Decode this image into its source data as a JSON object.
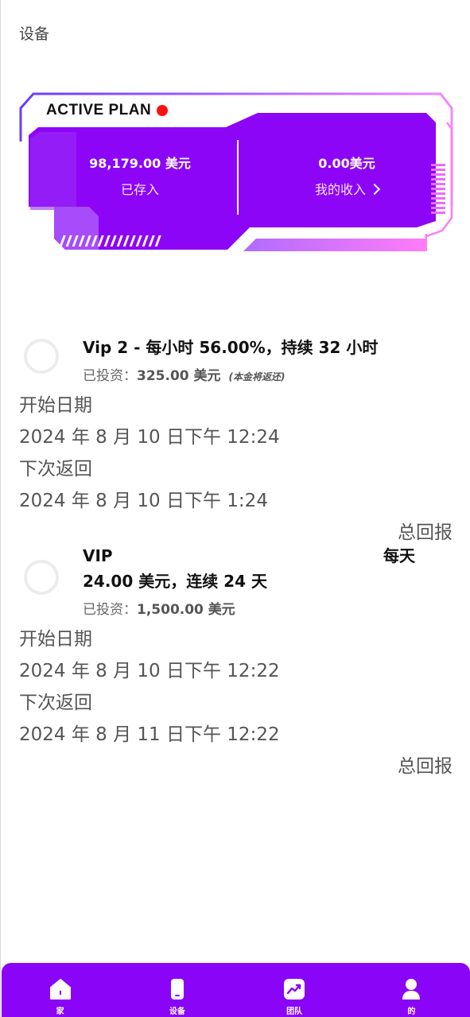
{
  "header": {
    "title": "设备"
  },
  "plan": {
    "title": "ACTIVE PLAN",
    "deposited_value": "98,179.00 美元",
    "deposited_label": "已存入",
    "income_value": "0.00美元",
    "income_label": "我的收入"
  },
  "investments": [
    {
      "title_line1": "Vip 2 - 每小时 56.00%，持续 32 小时",
      "title_line2": "",
      "invested_label": "已投资：",
      "invested_amount": "325.00 美元",
      "note": "(本金将返还)",
      "start_label": "开始日期",
      "start_value": "2024 年 8 月 10 日下午 12:24",
      "next_label": "下次返回",
      "next_value": "2024 年 8 月 10 日下午 1:24",
      "total_label": "总回报"
    },
    {
      "title_line1": "VIP",
      "title_line1_right": "每天",
      "title_line2": "24.00 美元，连续 24 天",
      "invested_label": "已投资：",
      "invested_amount": "1,500.00 美元",
      "note": "",
      "start_label": "开始日期",
      "start_value": "2024 年 8 月 10 日下午 12:22",
      "next_label": "下次返回",
      "next_value": "2024 年 8 月 11 日下午 12:22",
      "total_label": "总回报"
    }
  ],
  "nav": {
    "items": [
      {
        "label": "家",
        "icon": "home-icon"
      },
      {
        "label": "设备",
        "icon": "device-icon"
      },
      {
        "label": "团队",
        "icon": "team-icon"
      },
      {
        "label": "的",
        "icon": "user-icon"
      }
    ]
  },
  "colors": {
    "accent": "#8a05f8",
    "card_purple": "#8d05f6",
    "pink": "#e86cff",
    "status_dot": "#ff1010"
  }
}
